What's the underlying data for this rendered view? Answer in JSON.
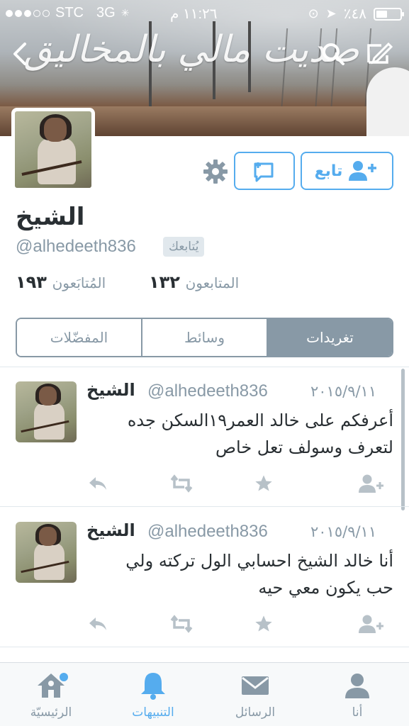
{
  "status_bar": {
    "carrier": "STC",
    "network": "3G",
    "time": "١١:٢٦ م",
    "battery": "٪٤٨",
    "battery_level": 0.48
  },
  "header": {
    "banner_text": "صديت مالي بالمخاليق"
  },
  "profile": {
    "display_name": "الشيخ",
    "handle": "@alhedeeth836",
    "follows_you": "يُتابعك",
    "follow_button": "تابع",
    "followers_count": "١٣٢",
    "followers_label": "المتابعون",
    "following_count": "١٩٣",
    "following_label": "المُتابَعون"
  },
  "tabs": [
    {
      "label": "تغريدات",
      "active": true
    },
    {
      "label": "وسائط",
      "active": false
    },
    {
      "label": "المفضّلات",
      "active": false
    }
  ],
  "tweets": [
    {
      "name": "الشيخ",
      "handle": "@alhedeeth836",
      "date": "٢٠١٥/٩/١١",
      "text": "أعرفكم على خالد العمر١٩السكن جده لتعرف وسولف تعل خاص"
    },
    {
      "name": "الشيخ",
      "handle": "@alhedeeth836",
      "date": "٢٠١٥/٩/١١",
      "text": "أنا خالد الشيخ احسابي الول تركته ولي حب يكون معي حيه"
    }
  ],
  "bottom_tabs": [
    {
      "label": "الرئيسيّة",
      "icon": "home-icon"
    },
    {
      "label": "التنبيهات",
      "icon": "bell-icon",
      "active": true
    },
    {
      "label": "الرسائل",
      "icon": "envelope-icon"
    },
    {
      "label": "أنا",
      "icon": "person-icon"
    }
  ],
  "colors": {
    "accent": "#55acee",
    "muted": "#8899a6",
    "text": "#292f33"
  }
}
